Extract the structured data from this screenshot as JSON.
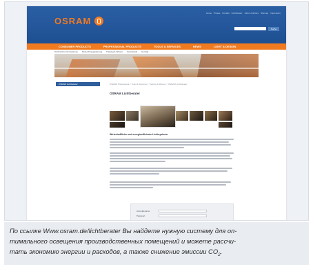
{
  "site": {
    "logo_text": "OSRAM",
    "top_links": [
      "Home",
      "Presse",
      "Kontakt",
      "Lichtberater",
      "Jobs & Karriere",
      "Sitemap",
      "Impressum"
    ],
    "search": {
      "placeholder": "",
      "button_label": "Suche"
    },
    "nav": [
      "CONSUMER PRODUCTS",
      "PROFESSIONAL PRODUCTS",
      "TOOLS & SERVICES",
      "NEWS",
      "LIGHT & DESIGN"
    ],
    "subnav": [
      "Technische Informationen",
      "Beleuchtungsplanung",
      "Training & Wissen",
      "Downloads",
      "Kontakt"
    ],
    "sidebar_tab": "OSRAM Lichtberater",
    "breadcrumb": "OSRAM Professional > Tools & Services > Training & Wissen > OSRAM Lichtberater",
    "page_title": "OSRAM Lichtberater",
    "subheading": "Wirtschaftliche und energieeffiziente Lichtsysteme",
    "login": {
      "user_label": "Anmeldename",
      "password_label": "Passwort"
    }
  },
  "caption": {
    "line1": "По ссылке Www.osram.de/lichtberater Вы найдете нужную систему для оп-",
    "line2": "тимального освещения производственных помещений и можете рассчи-",
    "line3_before": "тать экономию энергии и расходов, а также снижение эмиссии CO",
    "line3_sub": "2",
    "line3_after": "."
  },
  "colors": {
    "header_blue": "#1d4f92",
    "nav_orange": "#f07a1f",
    "logo_orange": "#f47a22",
    "caption_bg": "#e9ecf1"
  }
}
